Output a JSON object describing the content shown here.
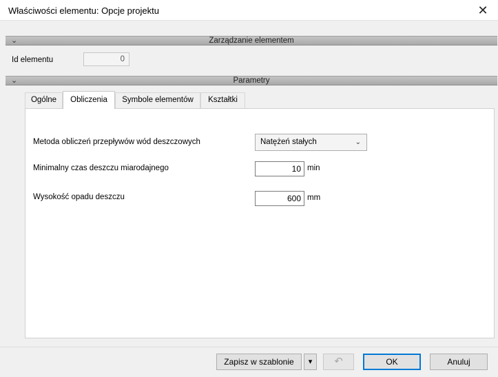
{
  "window": {
    "title": "Właściwości elementu: Opcje projektu",
    "close_glyph": "✕"
  },
  "sections": {
    "management": {
      "chevron": "⌄",
      "label": "Zarządzanie elementem"
    },
    "parameters": {
      "chevron": "⌄",
      "label": "Parametry"
    }
  },
  "element_id": {
    "label": "Id elementu",
    "value": "0"
  },
  "tabs": [
    {
      "label": "Ogólne",
      "active": false
    },
    {
      "label": "Obliczenia",
      "active": true
    },
    {
      "label": "Symbole elementów",
      "active": false
    },
    {
      "label": "Kształtki",
      "active": false
    }
  ],
  "calc": {
    "method": {
      "label": "Metoda obliczeń przepływów wód deszczowych",
      "value": "Natężeń stałych",
      "arrow": "⌄"
    },
    "min_rain": {
      "label": "Minimalny czas deszczu miarodajnego",
      "value": "10",
      "unit": "min"
    },
    "rain_height": {
      "label": "Wysokość opadu deszczu",
      "value": "600",
      "unit": "mm"
    }
  },
  "footer": {
    "save_template": "Zapisz w szablonie",
    "save_dropdown": "▾",
    "undo_glyph": "↶",
    "ok": "OK",
    "cancel": "Anuluj"
  },
  "colors": {
    "accent": "#0078d7",
    "section_bar": "#b3b3b3"
  },
  "icons": [
    "close-icon",
    "chevron-down-icon",
    "dropdown-arrow-icon",
    "undo-icon"
  ]
}
